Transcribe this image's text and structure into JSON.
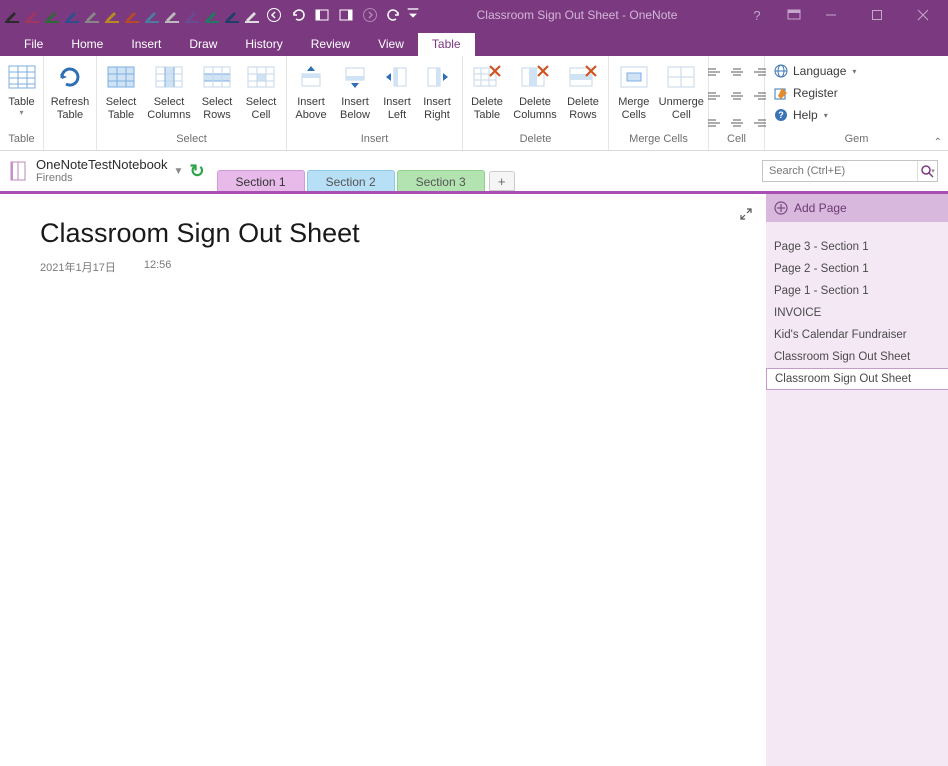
{
  "window": {
    "title": "Classroom Sign Out Sheet - OneNote",
    "help_q": "?"
  },
  "menus": {
    "file": "File",
    "home": "Home",
    "insert": "Insert",
    "draw": "Draw",
    "history": "History",
    "review": "Review",
    "view": "View",
    "table": "Table"
  },
  "ribbon": {
    "table_group": "Table",
    "table": {
      "l1": "Table"
    },
    "refresh": {
      "l1": "Refresh",
      "l2": "Table"
    },
    "select_group": "Select",
    "sel_table": {
      "l1": "Select",
      "l2": "Table"
    },
    "sel_cols": {
      "l1": "Select",
      "l2": "Columns"
    },
    "sel_rows": {
      "l1": "Select",
      "l2": "Rows"
    },
    "sel_cell": {
      "l1": "Select",
      "l2": "Cell"
    },
    "insert_group": "Insert",
    "ins_above": {
      "l1": "Insert",
      "l2": "Above"
    },
    "ins_below": {
      "l1": "Insert",
      "l2": "Below"
    },
    "ins_left": {
      "l1": "Insert",
      "l2": "Left"
    },
    "ins_right": {
      "l1": "Insert",
      "l2": "Right"
    },
    "delete_group": "Delete",
    "del_table": {
      "l1": "Delete",
      "l2": "Table"
    },
    "del_cols": {
      "l1": "Delete",
      "l2": "Columns"
    },
    "del_rows": {
      "l1": "Delete",
      "l2": "Rows"
    },
    "merge_group": "Merge Cells",
    "merge": {
      "l1": "Merge",
      "l2": "Cells"
    },
    "unmerge": {
      "l1": "Unmerge",
      "l2": "Cell"
    },
    "cell_group": "Cell",
    "gem_group": "Gem",
    "language": "Language",
    "register": "Register",
    "help": "Help"
  },
  "notebook": {
    "name": "OneNoteTestNotebook",
    "section_group": "Firends"
  },
  "sections": {
    "s1": "Section 1",
    "s2": "Section 2",
    "s3": "Section 3",
    "add": "+"
  },
  "search": {
    "placeholder": "Search (Ctrl+E)"
  },
  "page": {
    "title": "Classroom Sign Out Sheet",
    "date": "2021年1月17日",
    "time": "12:56"
  },
  "pages": {
    "add": "Add Page",
    "items": [
      "Page 3 - Section 1",
      "Page 2 - Section 1",
      "Page 1 - Section 1",
      "INVOICE",
      "Kid's Calendar Fundraiser",
      "Classroom Sign Out Sheet",
      "Classroom Sign Out Sheet"
    ],
    "selected_index": 6
  },
  "qat_pen_colors": [
    "#2b2b2b",
    "#a3355e",
    "#2c6b36",
    "#2b4f8f",
    "#545454",
    "#b78b1f",
    "#b84a2a",
    "#4a7d9e",
    "#8a8a8a",
    "#6b4a8f",
    "#1f7c62",
    "#1f3f6b"
  ]
}
